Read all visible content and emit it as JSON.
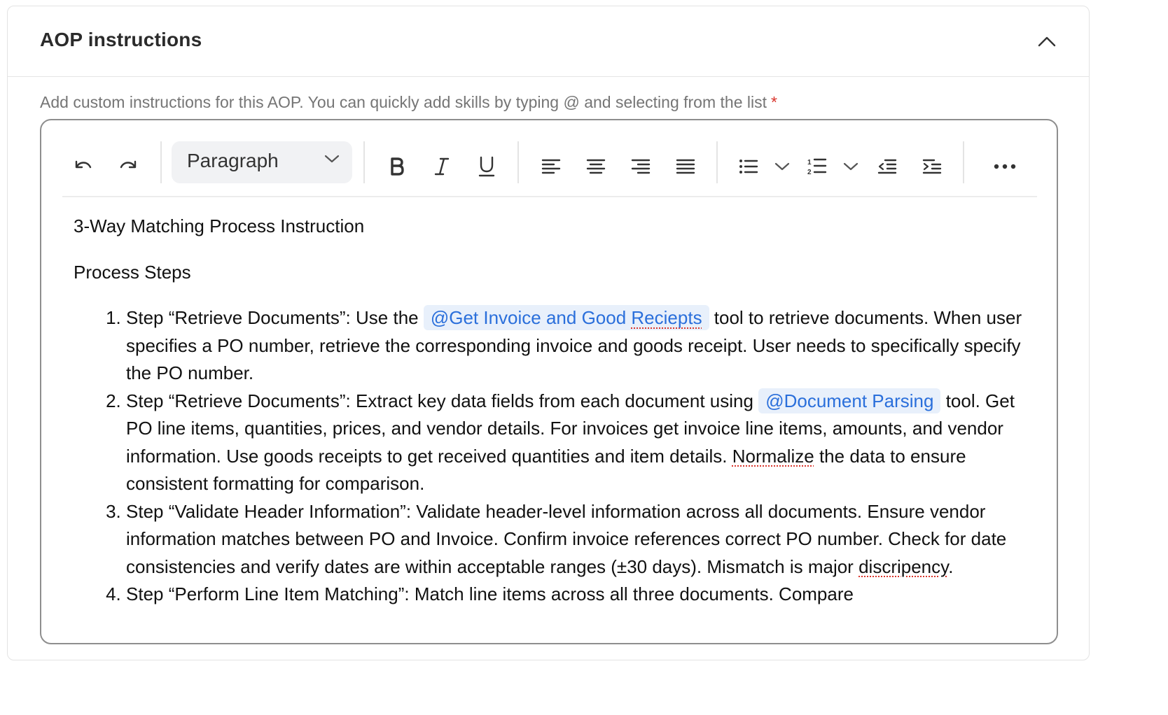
{
  "panel": {
    "title": "AOP instructions",
    "collapse_icon": "chevron-up-icon"
  },
  "field": {
    "label": "Add custom instructions for this AOP. You can quickly add skills by typing @ and selecting from the list",
    "required_marker": "*",
    "required_color": "#d9342b"
  },
  "toolbar": {
    "undo_icon": "undo-icon",
    "redo_icon": "redo-icon",
    "block_format": "Paragraph",
    "bold_icon": "bold-icon",
    "italic_icon": "italic-icon",
    "underline_icon": "underline-icon",
    "align_left_icon": "align-left-icon",
    "align_center_icon": "align-center-icon",
    "align_right_icon": "align-right-icon",
    "align_justify_icon": "align-justify-icon",
    "bullet_list_icon": "bullet-list-icon",
    "numbered_list_icon": "numbered-list-icon",
    "outdent_icon": "outdent-icon",
    "indent_icon": "indent-icon",
    "more_icon": "more-icon"
  },
  "editor": {
    "heading": "3-Way Matching Process Instruction",
    "subheading": "Process Steps",
    "mention_color": "#2a6fdb",
    "mention_bg": "#e8f0fb",
    "steps": [
      {
        "text_before": "Step “Retrieve Documents”: Use the ",
        "mention_part1": "@Get Invoice and Good ",
        "mention_part2": "Reciepts",
        "text_after": " tool to retrieve documents. When user specifies a PO number, retrieve the corresponding invoice and goods receipt. User needs to specifically specify the PO number."
      },
      {
        "text_before": "Step “Retrieve Documents”: Extract key data fields from each document using ",
        "mention": "@Document Parsing",
        "text_middle": " tool. Get PO line items, quantities, prices, and vendor details. For invoices get invoice line items, amounts, and vendor information. Use goods receipts to get received quantities and item details. ",
        "misspelled": "Normalize",
        "text_after": " the data to ensure consistent formatting for comparison."
      },
      {
        "text_before": "Step “Validate Header Information”: Validate header-level information across all documents. Ensure vendor information matches between PO and Invoice. Confirm invoice references correct PO number. Check for date consistencies and verify dates are within acceptable ranges (±30 days). Mismatch is major ",
        "misspelled": "discripency",
        "text_after": "."
      },
      {
        "text": "Step “Perform Line Item Matching”: Match line items across all three documents. Compare"
      }
    ]
  }
}
